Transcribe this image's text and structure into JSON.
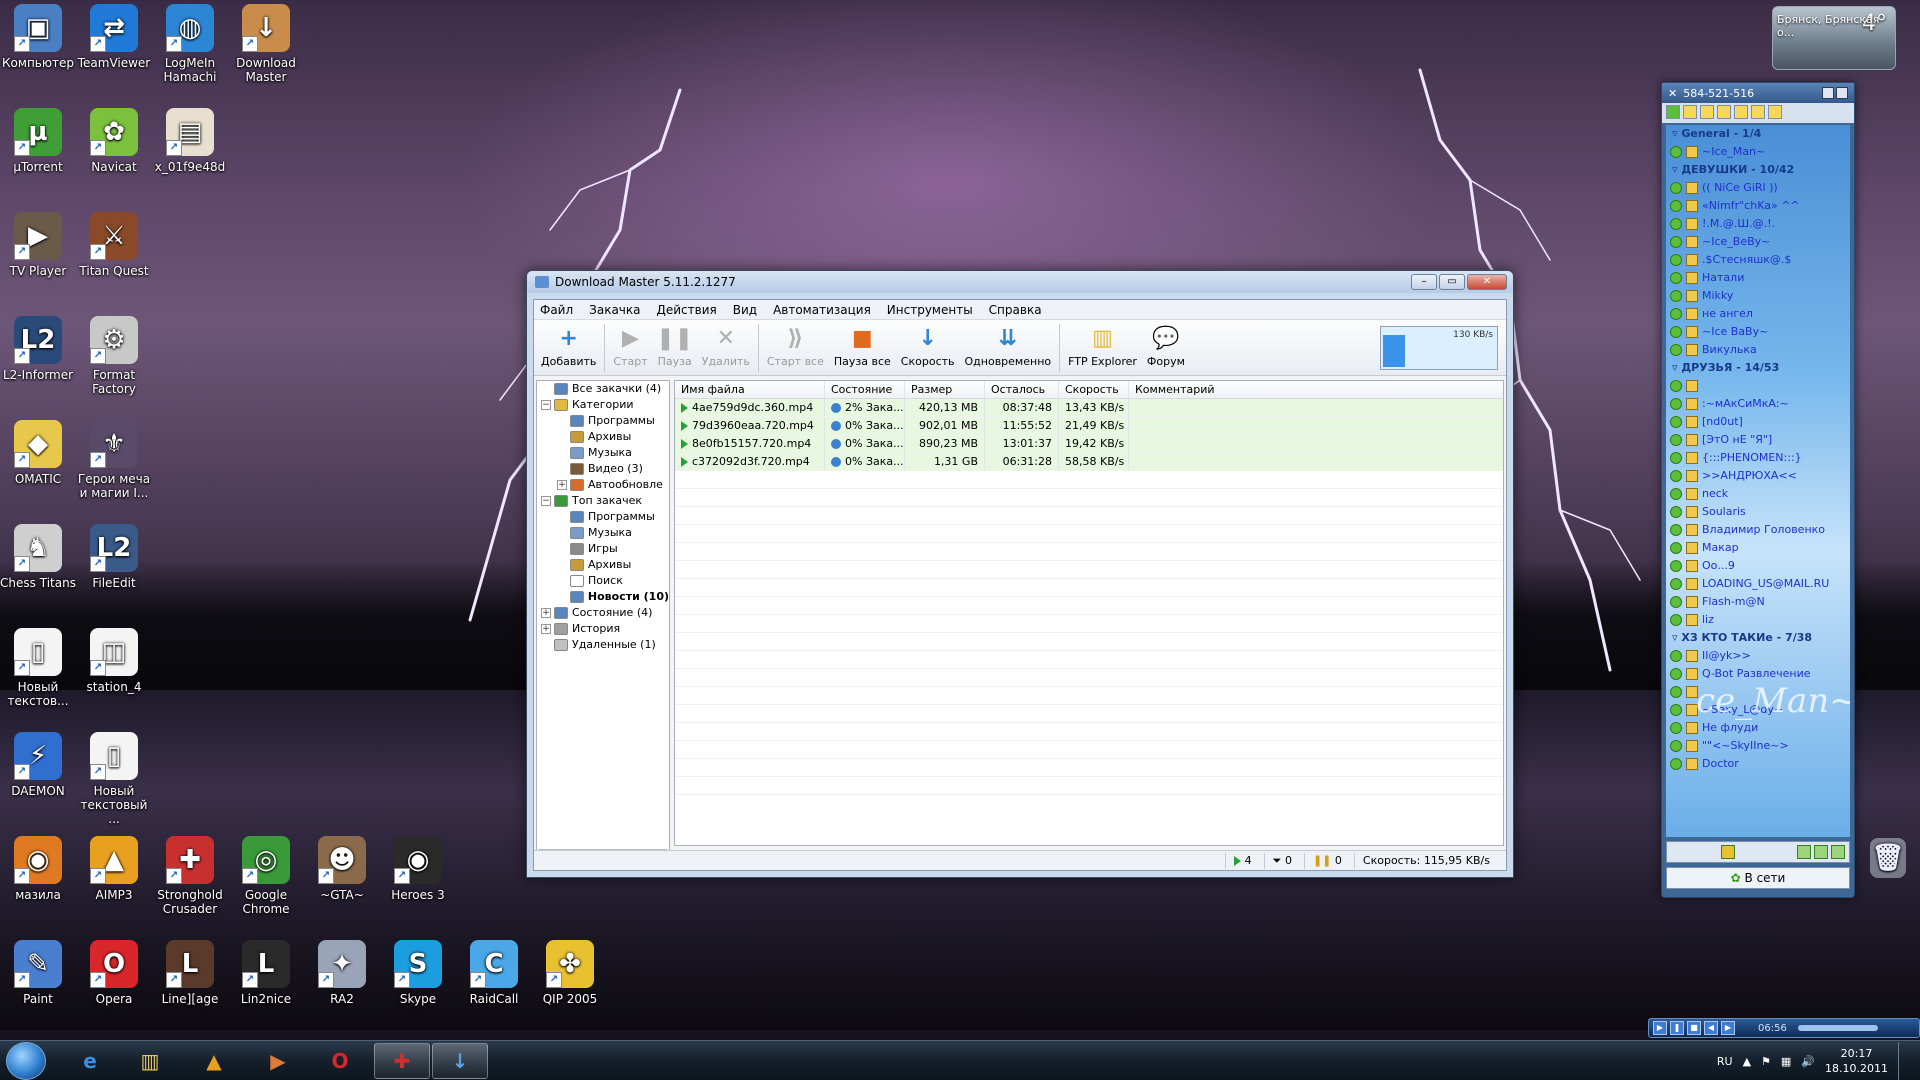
{
  "weather": {
    "temp": "4°",
    "city": "Брянск, Брянская о..."
  },
  "desktop_icons": [
    {
      "label": "Компьютер",
      "glyph": "▣",
      "color": "#4a7fc4"
    },
    {
      "label": "TeamViewer",
      "glyph": "⇄",
      "color": "#1f7ad8"
    },
    {
      "label": "LogMeIn Hamachi",
      "glyph": "◍",
      "color": "#2b86d6"
    },
    {
      "label": "Download Master",
      "glyph": "↓",
      "color": "#c98c4a"
    },
    {
      "label": "µTorrent",
      "glyph": "µ",
      "color": "#3f9e36"
    },
    {
      "label": "Navicat",
      "glyph": "✿",
      "color": "#7cc13e"
    },
    {
      "label": "x_01f9e48d",
      "glyph": "▤",
      "color": "#e8e0cf"
    },
    {
      "label": "TV Player",
      "glyph": "▶",
      "color": "#6a5a4a"
    },
    {
      "label": "Titan Quest",
      "glyph": "⚔",
      "color": "#8a4a2a"
    },
    {
      "label": "L2-Informer",
      "glyph": "L2",
      "color": "#2a4a7a"
    },
    {
      "label": "Format Factory",
      "glyph": "⚙",
      "color": "#c8c8c8"
    },
    {
      "label": "OMATIC",
      "glyph": "◆",
      "color": "#e8c84a"
    },
    {
      "label": "Герои меча и магии I...",
      "glyph": "⚜",
      "color": "#5a4a6a"
    },
    {
      "label": "Chess Titans",
      "glyph": "♞",
      "color": "#cfcfcf"
    },
    {
      "label": "FileEdit",
      "glyph": "L2",
      "color": "#3a5a8a"
    },
    {
      "label": "Новый текстов...",
      "glyph": "▯",
      "color": "#f4f4f4"
    },
    {
      "label": "station_4",
      "glyph": "◫",
      "color": "#f4f4f4"
    },
    {
      "label": "DAEMON",
      "glyph": "⚡",
      "color": "#2e6fd0"
    },
    {
      "label": "Новый текстовый ...",
      "glyph": "▯",
      "color": "#f4f4f4"
    },
    {
      "label": "мазила",
      "glyph": "◉",
      "color": "#e07a22"
    },
    {
      "label": "AIMP3",
      "glyph": "▲",
      "color": "#e8a020"
    },
    {
      "label": "Stronghold Crusader",
      "glyph": "✚",
      "color": "#c83030"
    },
    {
      "label": "Google Chrome",
      "glyph": "◎",
      "color": "#3a9a3a"
    },
    {
      "label": "~GTA~",
      "glyph": "☻",
      "color": "#8a6a4a"
    },
    {
      "label": "Heroes 3",
      "glyph": "◉",
      "color": "#2a2a2a"
    },
    {
      "label": "Paint",
      "glyph": "✎",
      "color": "#4a7fd0"
    },
    {
      "label": "Opera",
      "glyph": "O",
      "color": "#d8262a"
    },
    {
      "label": "Line][age",
      "glyph": "L",
      "color": "#5a3a2a"
    },
    {
      "label": "Lin2nice",
      "glyph": "L",
      "color": "#2a2a2a"
    },
    {
      "label": "RA2",
      "glyph": "✦",
      "color": "#9aa4b8"
    },
    {
      "label": "Skype",
      "glyph": "S",
      "color": "#1a9ee0"
    },
    {
      "label": "RaidCall",
      "glyph": "C",
      "color": "#4aa8e8"
    },
    {
      "label": "QIP 2005",
      "glyph": "✤",
      "color": "#e8c030"
    }
  ],
  "dm": {
    "title": "Download Master 5.11.2.1277",
    "menu": [
      "Файл",
      "Закачка",
      "Действия",
      "Вид",
      "Автоматизация",
      "Инструменты",
      "Справка"
    ],
    "toolbar": [
      {
        "label": "Добавить",
        "glyph": "+",
        "color": "#2f86d8",
        "disabled": false
      },
      {
        "label": "Старт",
        "glyph": "▶",
        "color": "#b0b0b0",
        "disabled": true
      },
      {
        "label": "Пауза",
        "glyph": "❚❚",
        "color": "#b0b0b0",
        "disabled": true
      },
      {
        "label": "Удалить",
        "glyph": "✕",
        "color": "#b0b0b0",
        "disabled": true
      },
      {
        "label": "Старт все",
        "glyph": "⟫",
        "color": "#b0b0b0",
        "disabled": true
      },
      {
        "label": "Пауза все",
        "glyph": "■",
        "color": "#e06a1e",
        "disabled": false
      },
      {
        "label": "Скорость",
        "glyph": "↓",
        "color": "#2f86d8",
        "disabled": false
      },
      {
        "label": "Одновременно",
        "glyph": "⇊",
        "color": "#2f86d8",
        "disabled": false
      },
      {
        "label": "FTP Explorer",
        "glyph": "▥",
        "color": "#e8b830",
        "disabled": false
      },
      {
        "label": "Форум",
        "glyph": "💬",
        "color": "#2f86d8",
        "disabled": false
      }
    ],
    "speed_graph_label": "130 KB/s",
    "tree": [
      {
        "label": "Все закачки (4)",
        "level": 0,
        "toggle": "",
        "bold": false,
        "color": "#5a84c0"
      },
      {
        "label": "Категории",
        "level": 0,
        "toggle": "−",
        "bold": false,
        "color": "#e2b840"
      },
      {
        "label": "Программы",
        "level": 1,
        "toggle": "",
        "bold": false,
        "color": "#5a84c0"
      },
      {
        "label": "Архивы",
        "level": 1,
        "toggle": "",
        "bold": false,
        "color": "#c89a3a"
      },
      {
        "label": "Музыка",
        "level": 1,
        "toggle": "",
        "bold": false,
        "color": "#7a9ac8"
      },
      {
        "label": "Видео (3)",
        "level": 1,
        "toggle": "",
        "bold": false,
        "color": "#7a5a3a"
      },
      {
        "label": "Автообновле",
        "level": 1,
        "toggle": "+",
        "bold": false,
        "color": "#d86a2a"
      },
      {
        "label": "Топ закачек",
        "level": 0,
        "toggle": "−",
        "bold": false,
        "color": "#3a9a3a"
      },
      {
        "label": "Программы",
        "level": 1,
        "toggle": "",
        "bold": false,
        "color": "#5a84c0"
      },
      {
        "label": "Музыка",
        "level": 1,
        "toggle": "",
        "bold": false,
        "color": "#7a9ac8"
      },
      {
        "label": "Игры",
        "level": 1,
        "toggle": "",
        "bold": false,
        "color": "#8a8a8a"
      },
      {
        "label": "Архивы",
        "level": 1,
        "toggle": "",
        "bold": false,
        "color": "#c89a3a"
      },
      {
        "label": "Поиск",
        "level": 1,
        "toggle": "",
        "bold": false,
        "color": "#ffffff"
      },
      {
        "label": "Новости (10)",
        "level": 1,
        "toggle": "",
        "bold": true,
        "color": "#5a84c0"
      },
      {
        "label": "Состояние (4)",
        "level": 0,
        "toggle": "+",
        "bold": false,
        "color": "#5a84c0"
      },
      {
        "label": "История",
        "level": 0,
        "toggle": "+",
        "bold": false,
        "color": "#a0a0a0"
      },
      {
        "label": "Удаленные (1)",
        "level": 0,
        "toggle": "",
        "bold": false,
        "color": "#c0c0c0"
      }
    ],
    "columns": [
      "Имя файла",
      "Состояние",
      "Размер",
      "Осталось",
      "Скорость",
      "Комментарий"
    ],
    "rows": [
      {
        "name": "4ae759d9dc.360.mp4",
        "state": "2% Зака...",
        "size": "420,13 MB",
        "left": "08:37:48",
        "speed": "13,43 KB/s",
        "comment": ""
      },
      {
        "name": "79d3960eaa.720.mp4",
        "state": "0% Зака...",
        "size": "902,01 MB",
        "left": "11:55:52",
        "speed": "21,49 KB/s",
        "comment": ""
      },
      {
        "name": "8e0fb15157.720.mp4",
        "state": "0% Зака...",
        "size": "890,23 MB",
        "left": "13:01:37",
        "speed": "19,42 KB/s",
        "comment": ""
      },
      {
        "name": "c372092d3f.720.mp4",
        "state": "0% Зака...",
        "size": "1,31 GB",
        "left": "06:31:28",
        "speed": "58,58 KB/s",
        "comment": ""
      }
    ],
    "status": {
      "active": "4",
      "paused": "0",
      "errors": "0",
      "speed": "Скорость: 115,95 KB/s"
    }
  },
  "qip": {
    "title": "584-521-516",
    "groups": [
      {
        "name": "General - 1/4",
        "contacts": [
          "~Ice_Man~"
        ]
      },
      {
        "name": "ДЕВУШКИ - 10/42",
        "contacts": [
          "(( NiCe GiRl ))",
          "«Nimfr\"chKa» ^^",
          "!.M.@.Ш.@.!.",
          "~Ice_BeBy~",
          ".$Стесняшк@.$",
          "Натали",
          "Mikky",
          "не ангел",
          "~Ice BaBy~",
          "Викулька"
        ]
      },
      {
        "name": "ДРУЗЬЯ - 14/53",
        "contacts": [
          "",
          ":~мАкСиМкА:~",
          "[nd0ut]",
          "[ЭтО нЕ \"Я\"]",
          "{:::PHENOMEN:::}",
          ">>АНДРЮХА<<",
          "neck",
          "Soularis",
          "Владимир Головенко",
          "Макар",
          "Оо...9",
          "LOADING_US@MAIL.RU",
          "Flash-m@N",
          "liz"
        ]
      },
      {
        "name": "ХЗ КТО ТАКИе - 7/38",
        "contacts": [
          "II@yk>>",
          "Q-Bot Развлечение",
          "",
          "~Sexy_L@dy~",
          "Не флуди",
          "\"\"<~SkyIIne~>",
          "Doctor"
        ]
      }
    ],
    "watermark": "ce_Man~",
    "status_label": "В сети"
  },
  "mini_player": {
    "time": "06:56"
  },
  "taskbar": {
    "lang": "RU",
    "time": "20:17",
    "date": "18.10.2011",
    "items": [
      {
        "glyph": "e",
        "color": "#3a8fe0",
        "active": false
      },
      {
        "glyph": "▥",
        "color": "#e8c860",
        "active": false
      },
      {
        "glyph": "▲",
        "color": "#e8a020",
        "active": false
      },
      {
        "glyph": "▶",
        "color": "#e07a3a",
        "active": false
      },
      {
        "glyph": "O",
        "color": "#d8262a",
        "active": false
      },
      {
        "glyph": "✚",
        "color": "#d03030",
        "active": true
      },
      {
        "glyph": "↓",
        "color": "#5aa0e0",
        "active": true
      }
    ]
  },
  "recycle_label": "Корзина"
}
